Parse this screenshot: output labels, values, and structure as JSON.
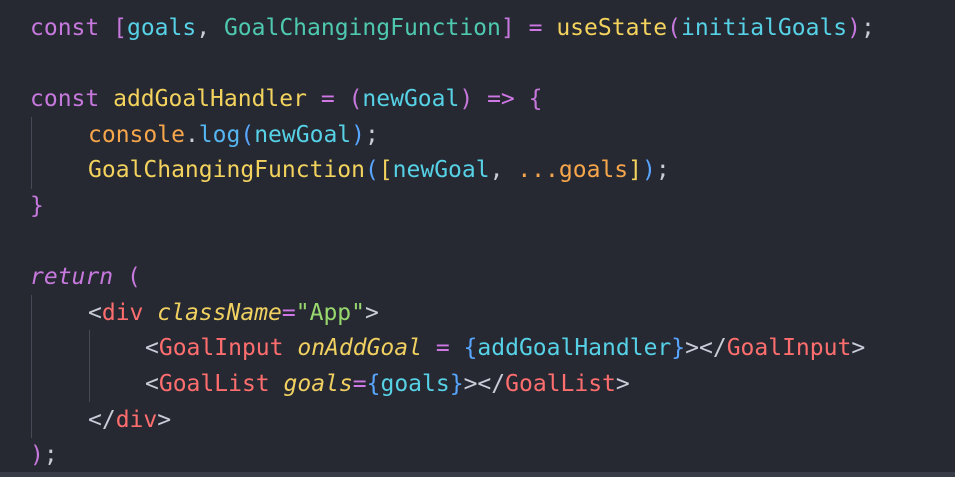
{
  "code": {
    "line1": {
      "const": "const",
      "open_bracket": "[",
      "goals": "goals",
      "comma": ",",
      "setter": "GoalChangingFunction",
      "close_bracket": "]",
      "equals": "=",
      "use_state": "useState",
      "open_paren": "(",
      "initial_goals": "initialGoals",
      "close_paren": ")",
      "semicolon": ";"
    },
    "line3": {
      "const": "const",
      "handler": "addGoalHandler",
      "equals": "=",
      "open_paren": "(",
      "param": "newGoal",
      "close_paren": ")",
      "arrow": "=>",
      "open_brace": "{"
    },
    "line4": {
      "console": "console",
      "dot": ".",
      "log": "log",
      "open_paren": "(",
      "arg": "newGoal",
      "close_paren": ")",
      "semicolon": ";"
    },
    "line5": {
      "setter": "GoalChangingFunction",
      "open_paren": "(",
      "open_bracket": "[",
      "new_goal": "newGoal",
      "comma": ",",
      "spread": "...goals",
      "close_bracket": "]",
      "close_paren": ")",
      "semicolon": ";"
    },
    "line6": {
      "close_brace": "}"
    },
    "line8": {
      "return": "return",
      "open_paren": "("
    },
    "line9": {
      "lt": "<",
      "tag": "div",
      "attr": "className",
      "equals": "=",
      "value": "\"App\"",
      "gt": ">"
    },
    "line10": {
      "lt": "<",
      "tag": "GoalInput",
      "attr": "onAddGoal",
      "equals": "=",
      "open_brace": "{",
      "value": "addGoalHandler",
      "close_brace": "}",
      "close_tag_open": "></",
      "close_tag": "GoalInput",
      "gt": ">"
    },
    "line11": {
      "lt": "<",
      "tag": "GoalList",
      "attr": "goals",
      "equals": "=",
      "open_brace": "{",
      "value": "goals",
      "close_brace": "}",
      "close_tag_open": "></",
      "close_tag": "GoalList",
      "gt": ">"
    },
    "line12": {
      "close_open": "</",
      "tag": "div",
      "gt": ">"
    },
    "line13": {
      "close_paren": ")",
      "semicolon": ";"
    }
  }
}
